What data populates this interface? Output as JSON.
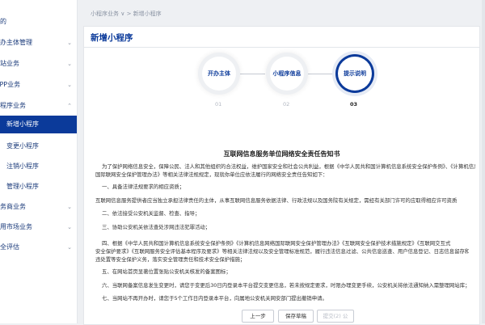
{
  "sidebar": {
    "items": [
      {
        "label": "我的",
        "chev": ""
      },
      {
        "label": "开办主体管理",
        "chev": "⌄"
      },
      {
        "label": "网站业务",
        "chev": "⌄"
      },
      {
        "label": "APP业务",
        "chev": "⌄"
      },
      {
        "label": "小程序业务",
        "chev": "⌃"
      },
      {
        "label": "新增小程序",
        "chev": ""
      },
      {
        "label": "变更小程序",
        "chev": ""
      },
      {
        "label": "注销小程序",
        "chev": ""
      },
      {
        "label": "管理小程序",
        "chev": ""
      },
      {
        "label": "服务商业务",
        "chev": "⌄"
      },
      {
        "label": "应用市场业务",
        "chev": "⌄"
      },
      {
        "label": "安全评估",
        "chev": "⌄"
      }
    ]
  },
  "breadcrumb": {
    "root": "小程序业务",
    "sep": "∨ >",
    "current": "新增小程序"
  },
  "page": {
    "title": "新增小程序"
  },
  "steps": [
    {
      "label": "开办主体",
      "num": "01"
    },
    {
      "label": "小程序信息",
      "num": "02"
    },
    {
      "label": "提示说明",
      "num": "03"
    }
  ],
  "doc": {
    "title": "互联网信息服务单位网络安全责任告知书",
    "paragraphs": [
      "为了保护网络信息安全，保障公民、法人和其他组织的合法权益，维护国家安全和社会公共利益，根据《中华人民共和国计算机信息系统安全保护条例》、《计算机信息",
      "国际联网安全保护管理办法》等相关法律法规规定，现就你单位应依法履行的网络安全责任告知如下：",
      "一、具备法律法规要求的相应资质；",
      "互联网信息服务提供者应当独立承担法律责任的主体，从事互联网信息服务依据法律、行政法规以及国务院有关规定，需经有关部门许可的应取得相应许可资质",
      "二、依法接受公安机关监督、检查、指导；",
      "三、协助公安机关依法查处涉网违法犯罪活动；",
      "四、根据《中华人民共和国计算机信息系统安全保护条例》《计算机信息网络国际联网安全保护管理办法》《互联网安全保护技术措施规定》《互联网交互式",
      "安全保护要求》《互联网服务安全评估基本程序及要求》等相关法律法规以及安全管理标准规范，履行违法信息过滤、公共信息巡查、用户信息登记、日志信息留存和应急",
      "违处置等安全保护义务，落实安全管理责任和技术安全保护措施；",
      "五、在网站首页显著位置张贴公安机关核发的备案图标；",
      "六、当联网备案信息发生变更时，请您于变更后30日内登录本平台提交变更信息，若未按规定要求，时限办理变更手续，公安机关将依法通知纳入需整理网站库；",
      "七、当网站不再开办时，请您于5个工作日内登录本平台，向属地公安机关网安部门提出撤销申请。"
    ]
  },
  "buttons": {
    "prev": "上一步",
    "save": "保存草稿",
    "submit": "提交(2) 公"
  }
}
